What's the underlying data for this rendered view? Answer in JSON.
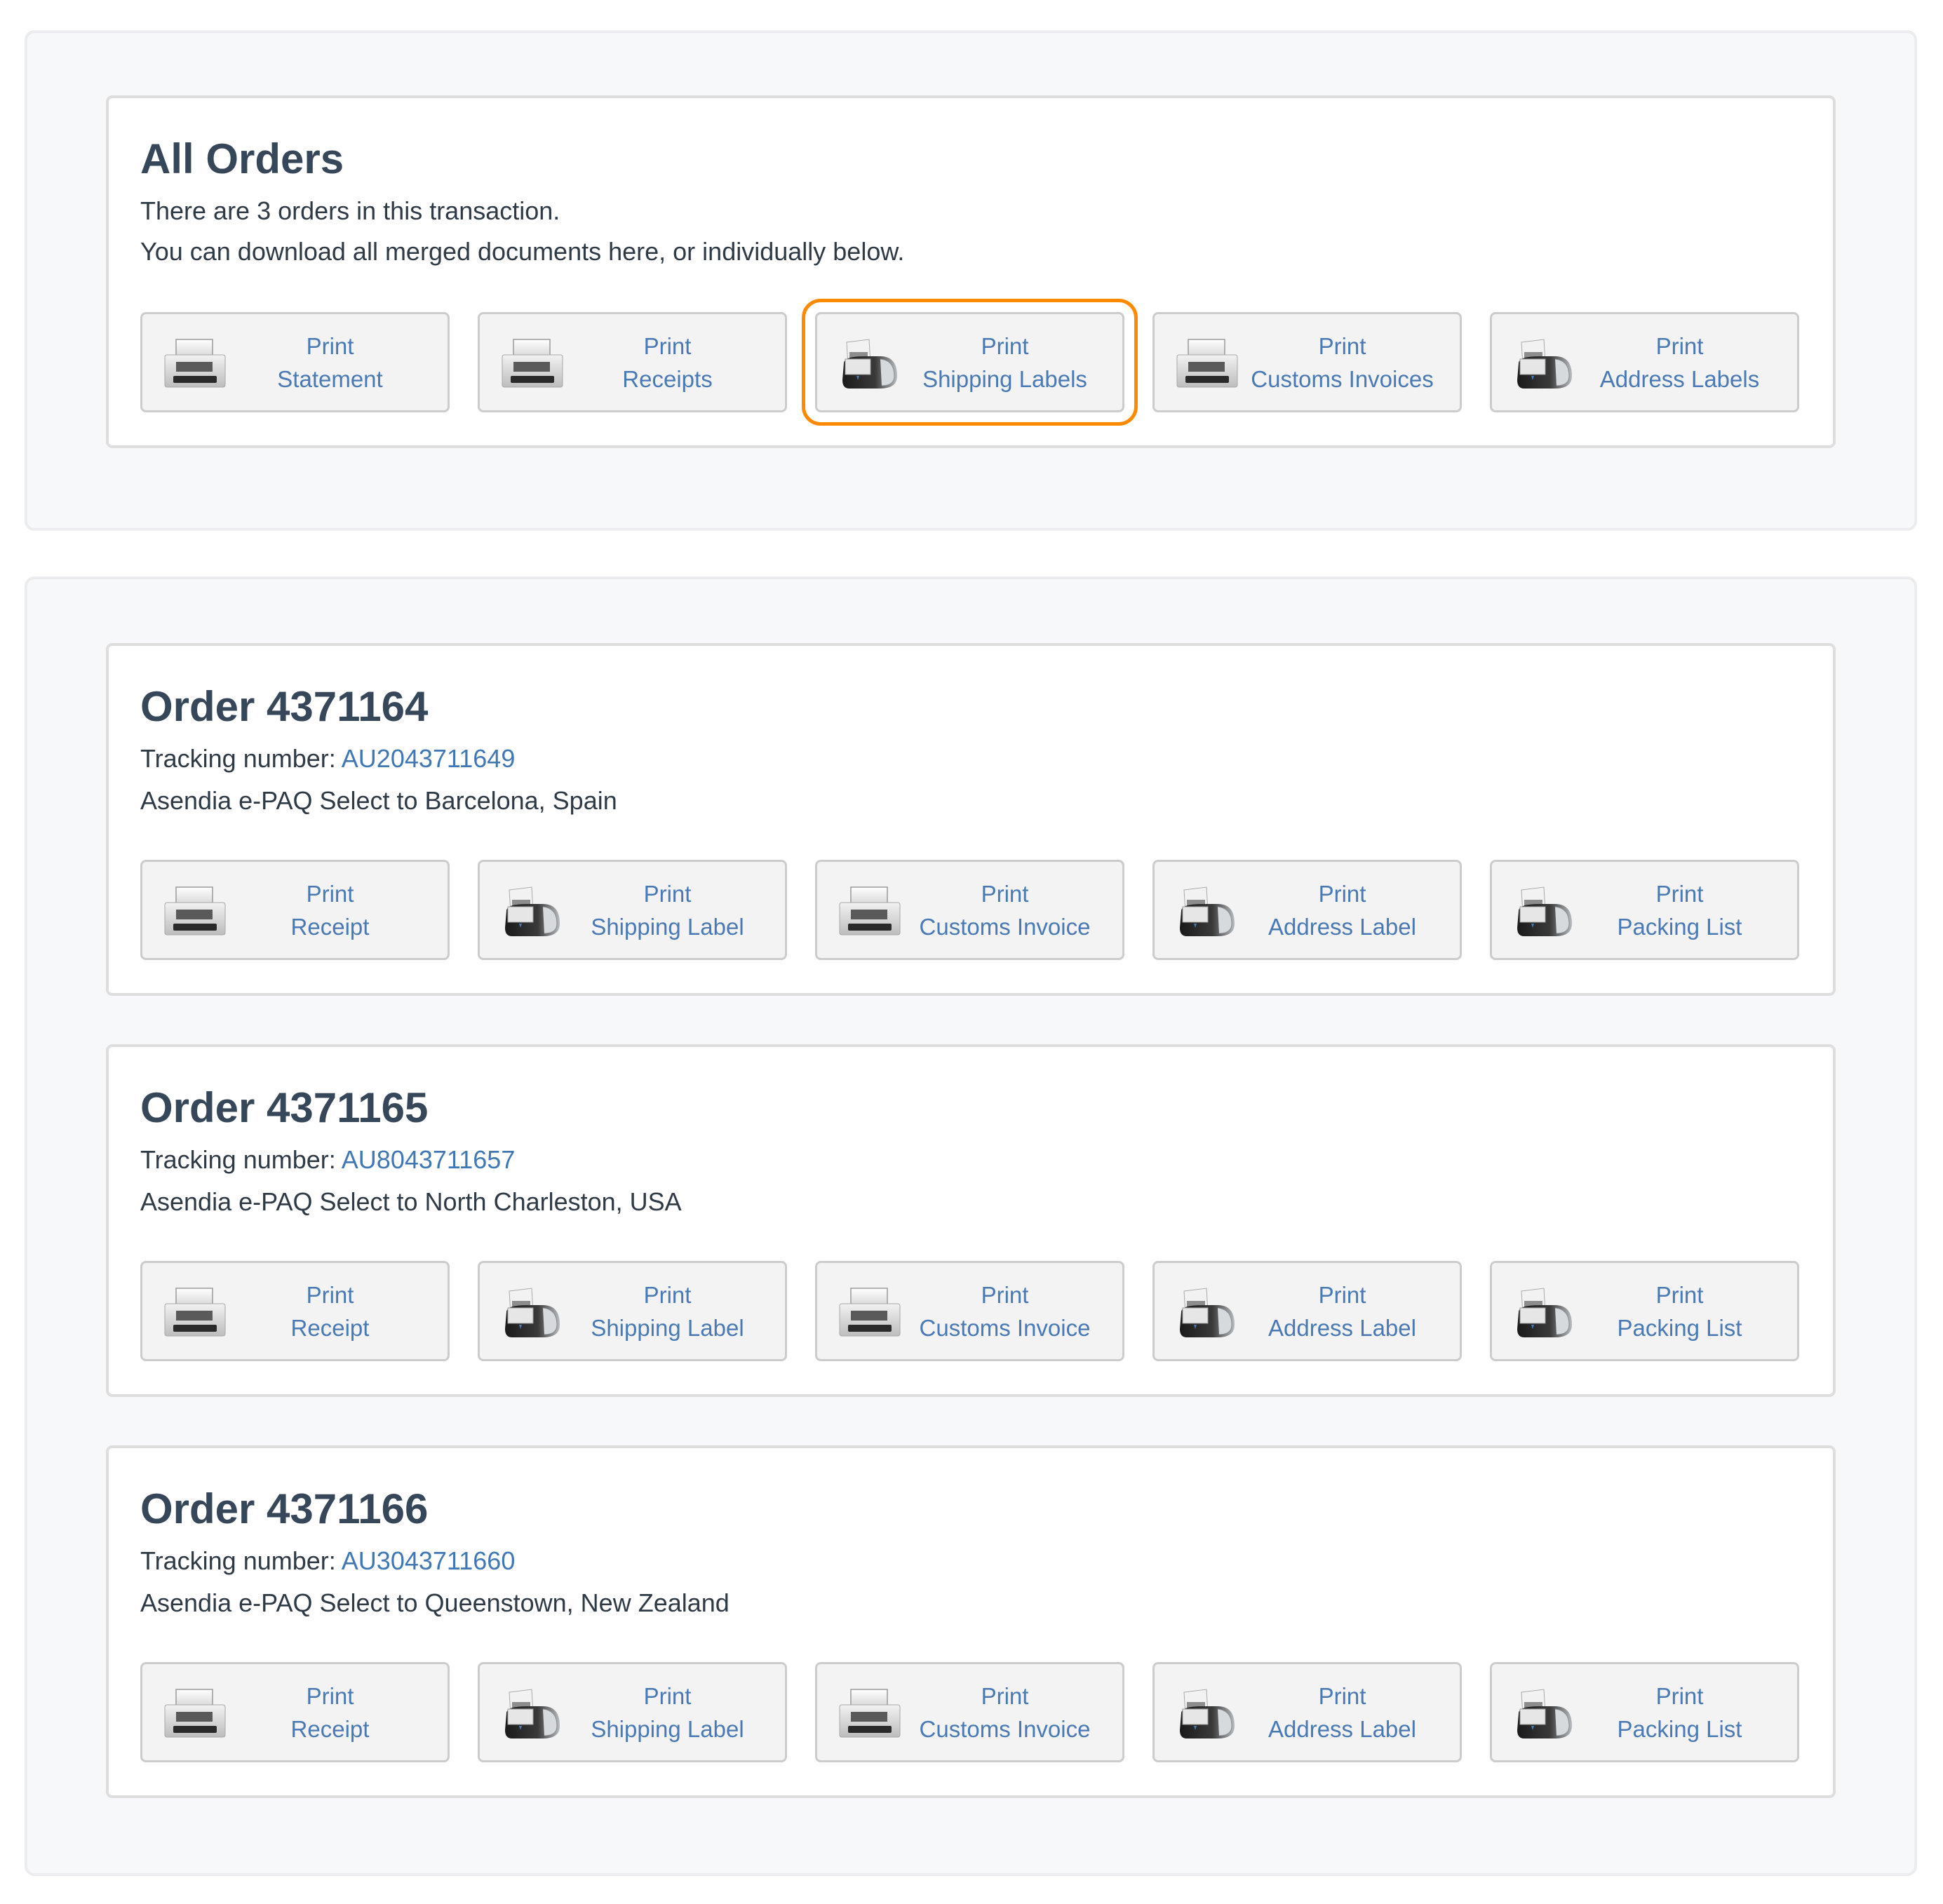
{
  "all_orders": {
    "title": "All Orders",
    "summary": "There are 3 orders in this transaction.",
    "instructions": "You can download all merged documents here, or individually below.",
    "buttons": [
      {
        "line1": "Print",
        "line2": "Statement",
        "icon": "printer-icon",
        "highlighted": false
      },
      {
        "line1": "Print",
        "line2": "Receipts",
        "icon": "printer-icon",
        "highlighted": false
      },
      {
        "line1": "Print",
        "line2": "Shipping Labels",
        "icon": "label-printer-icon",
        "highlighted": true
      },
      {
        "line1": "Print",
        "line2": "Customs Invoices",
        "icon": "printer-icon",
        "highlighted": false
      },
      {
        "line1": "Print",
        "line2": "Address Labels",
        "icon": "label-printer-icon",
        "highlighted": false
      }
    ]
  },
  "highlight_color": "#ff8a00",
  "orders": [
    {
      "title": "Order 4371164",
      "tracking_label": "Tracking number: ",
      "tracking_number": "AU2043711649",
      "description": "Asendia e-PAQ Select to Barcelona, Spain",
      "buttons": [
        {
          "line1": "Print",
          "line2": "Receipt",
          "icon": "printer-icon"
        },
        {
          "line1": "Print",
          "line2": "Shipping Label",
          "icon": "label-printer-icon"
        },
        {
          "line1": "Print",
          "line2": "Customs Invoice",
          "icon": "printer-icon"
        },
        {
          "line1": "Print",
          "line2": "Address Label",
          "icon": "label-printer-icon"
        },
        {
          "line1": "Print",
          "line2": "Packing List",
          "icon": "label-printer-icon"
        }
      ]
    },
    {
      "title": "Order 4371165",
      "tracking_label": "Tracking number: ",
      "tracking_number": "AU8043711657",
      "description": "Asendia e-PAQ Select to North Charleston, USA",
      "buttons": [
        {
          "line1": "Print",
          "line2": "Receipt",
          "icon": "printer-icon"
        },
        {
          "line1": "Print",
          "line2": "Shipping Label",
          "icon": "label-printer-icon"
        },
        {
          "line1": "Print",
          "line2": "Customs Invoice",
          "icon": "printer-icon"
        },
        {
          "line1": "Print",
          "line2": "Address Label",
          "icon": "label-printer-icon"
        },
        {
          "line1": "Print",
          "line2": "Packing List",
          "icon": "label-printer-icon"
        }
      ]
    },
    {
      "title": "Order 4371166",
      "tracking_label": "Tracking number: ",
      "tracking_number": "AU3043711660",
      "description": "Asendia e-PAQ Select to Queenstown, New Zealand",
      "buttons": [
        {
          "line1": "Print",
          "line2": "Receipt",
          "icon": "printer-icon"
        },
        {
          "line1": "Print",
          "line2": "Shipping Label",
          "icon": "label-printer-icon"
        },
        {
          "line1": "Print",
          "line2": "Customs Invoice",
          "icon": "printer-icon"
        },
        {
          "line1": "Print",
          "line2": "Address Label",
          "icon": "label-printer-icon"
        },
        {
          "line1": "Print",
          "line2": "Packing List",
          "icon": "label-printer-icon"
        }
      ]
    }
  ]
}
